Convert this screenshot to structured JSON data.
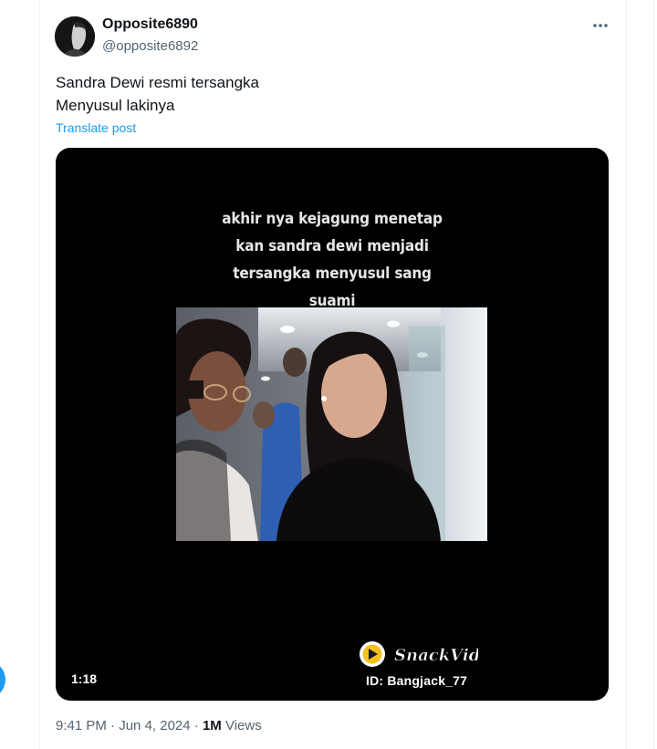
{
  "colors": {
    "accent": "#1d9bf0",
    "text_primary": "#0f1419",
    "text_secondary": "#536471",
    "media_background": "#000000"
  },
  "author": {
    "display_name": "Opposite6890",
    "handle": "@opposite6892",
    "avatar_icon": "avatar"
  },
  "menu": {
    "icon": "more-horizontal-icon"
  },
  "post": {
    "text_lines": [
      "Sandra Dewi resmi tersangka",
      "Menyusul lakinya"
    ],
    "translate_label": "Translate post"
  },
  "video": {
    "caption_lines": [
      "akhir nya kejagung menetap",
      "kan sandra dewi menjadi",
      "tersangka menyusul sang",
      "suami"
    ],
    "duration": "1:18",
    "watermark_brand": "SnackVideo",
    "watermark_id": "ID: Bangjack_77"
  },
  "meta": {
    "time": "9:41 PM",
    "separator": "·",
    "date": "Jun 4, 2024",
    "views_count": "1M",
    "views_label": "Views"
  }
}
